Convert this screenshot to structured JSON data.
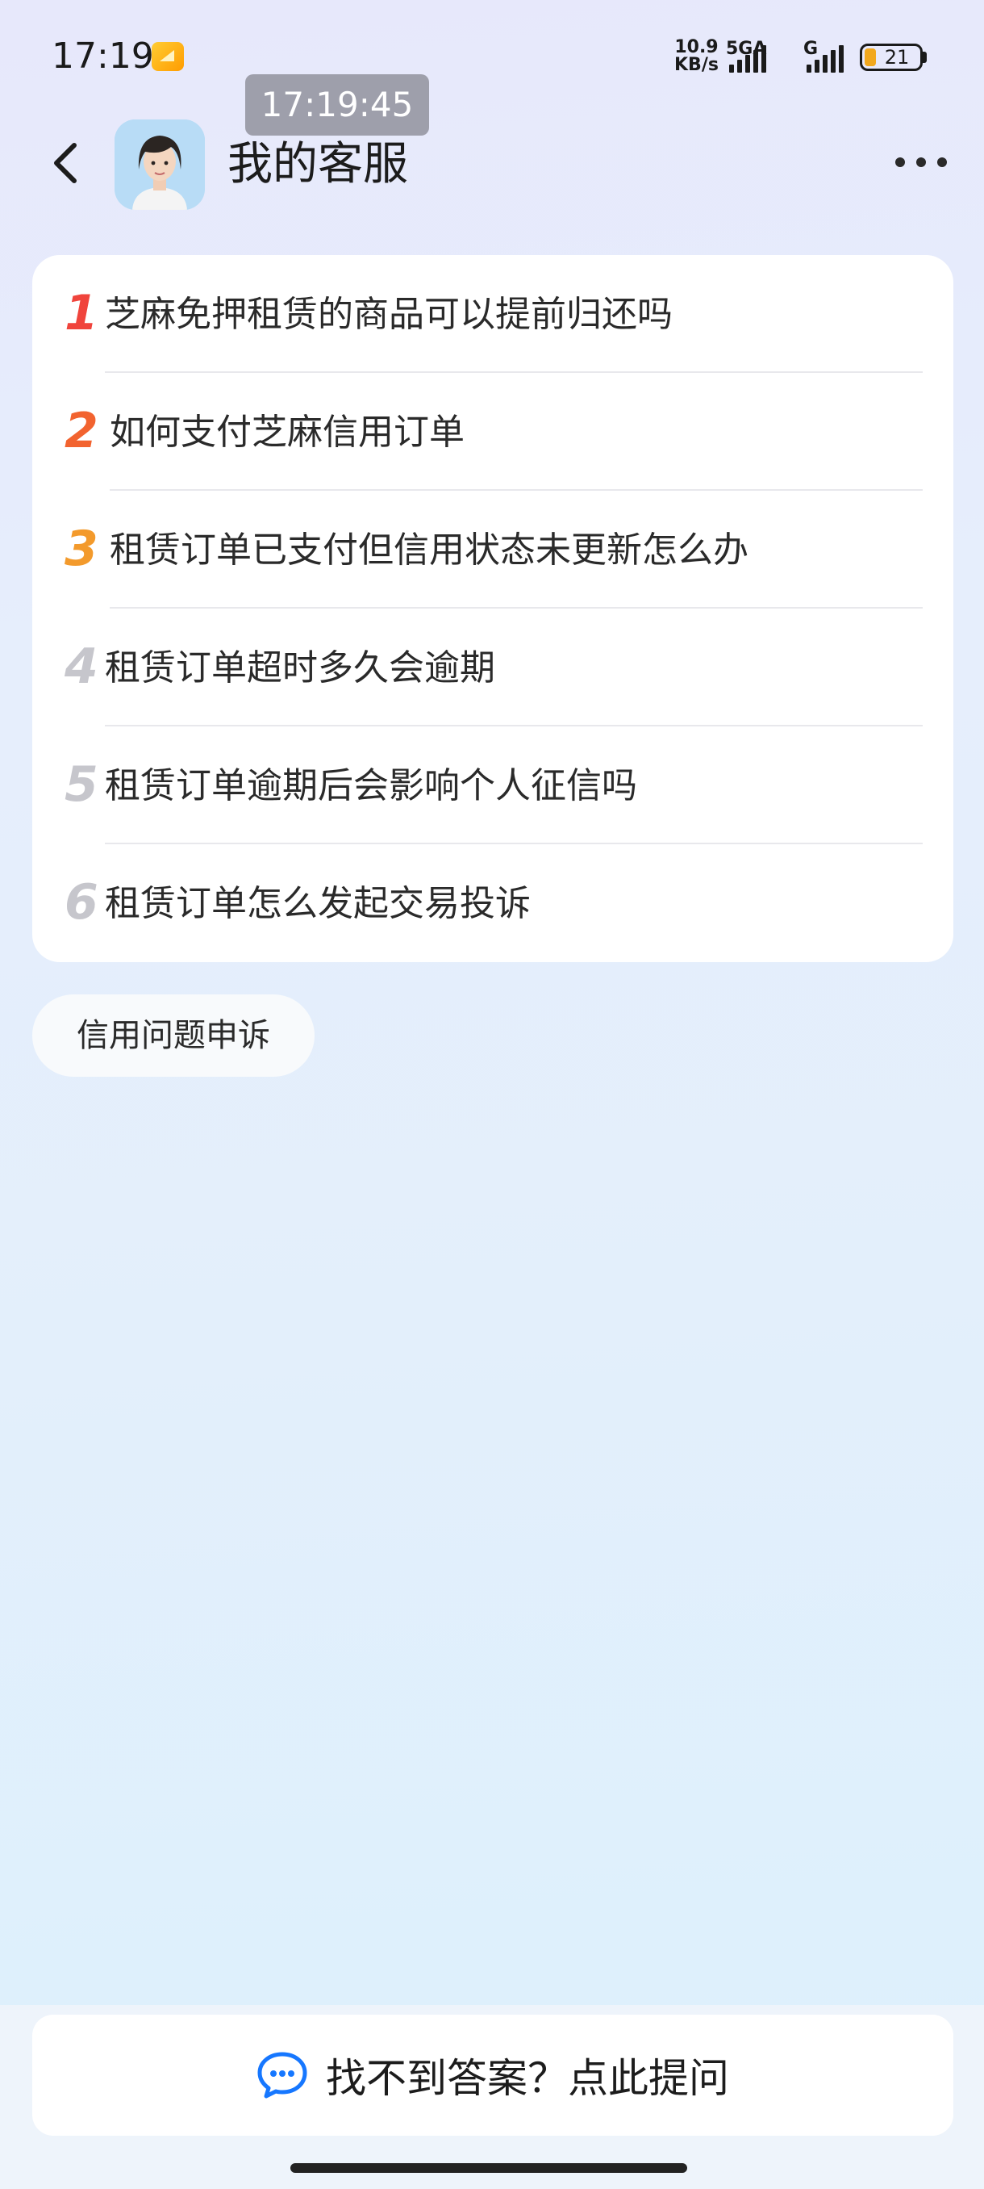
{
  "status_bar": {
    "time": "17:19",
    "net_speed_value": "10.9",
    "net_speed_unit": "KB/s",
    "sim1_tag": "5GA",
    "sim2_tag": "G",
    "battery": "21",
    "notification_icon": "notification-app-icon"
  },
  "timestamp_overlay": "17:19:45",
  "header": {
    "title": "我的客服",
    "back_icon": "chevron-left-icon",
    "more_icon": "more-horizontal-icon"
  },
  "faq": {
    "items": [
      {
        "num": "1",
        "text": "芝麻免押租赁的商品可以提前归还吗",
        "color": "#f0443c"
      },
      {
        "num": "2",
        "text": "如何支付芝麻信用订单",
        "color": "#f2632f"
      },
      {
        "num": "3",
        "text": "租赁订单已支付但信用状态未更新怎么办",
        "color": "#f39a2c"
      },
      {
        "num": "4",
        "text": "租赁订单超时多久会逾期",
        "color": "#c6c6cc"
      },
      {
        "num": "5",
        "text": "租赁订单逾期后会影响个人征信吗",
        "color": "#c6c6cc"
      },
      {
        "num": "6",
        "text": "租赁订单怎么发起交易投诉",
        "color": "#c6c6cc"
      }
    ]
  },
  "chip": {
    "label": "信用问题申诉"
  },
  "ask_button": {
    "label": "找不到答案？点此提问",
    "icon": "chat-bubble-icon",
    "icon_color": "#1677ff"
  }
}
